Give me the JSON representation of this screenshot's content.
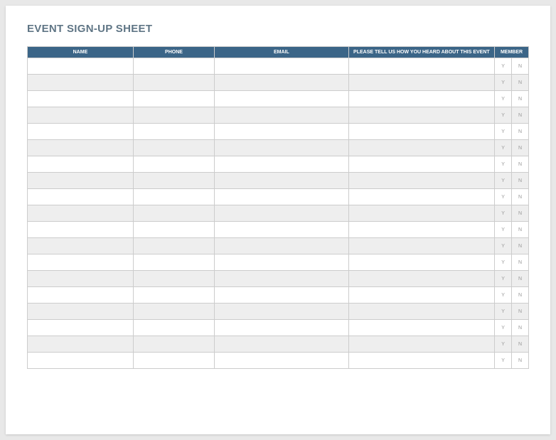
{
  "title": "EVENT SIGN-UP SHEET",
  "columns": {
    "name": "NAME",
    "phone": "PHONE",
    "email": "EMAIL",
    "heard": "PLEASE TELL US HOW YOU HEARD ABOUT THIS EVENT",
    "member": "MEMBER"
  },
  "member_options": {
    "yes": "Y",
    "no": "N"
  },
  "row_count": 19
}
